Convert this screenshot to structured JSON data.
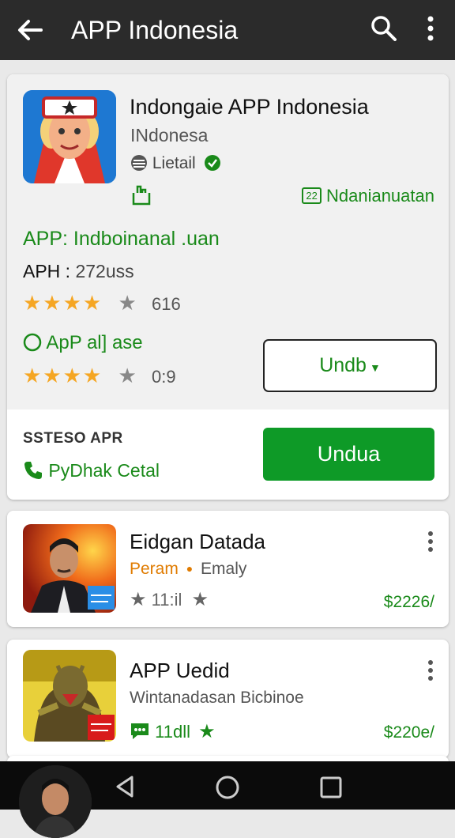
{
  "appbar": {
    "title": "APP Indonesia"
  },
  "featured": {
    "name": "Indongaie APP Indonesia",
    "developer": "INdonesa",
    "publisher": "Lietail",
    "note": "Ndanianuatan",
    "note_number": "22",
    "headline": "APP: Indboinanal .uan",
    "aph_label": "APH :",
    "aph_value": "272uss",
    "rating1_value": "616",
    "status": "ApP al] ase",
    "rating2_value": "0:9",
    "dropdown_label": "Undb",
    "section_label": "SSTESO APR",
    "contact": "PyDhak Cetal",
    "install_label": "Undua"
  },
  "list": [
    {
      "title": "Eidgan Datada",
      "tag1": "Peram",
      "tag2": "Emaly",
      "rating": "11:il",
      "price": "$2226/",
      "badge": "Xdo"
    },
    {
      "title": "APP Uedid",
      "subtitle": "Wintanadasan Bicbinoe",
      "rating": "11dll",
      "price": "$220e/",
      "badge": "Xdo"
    }
  ],
  "colors": {
    "accent": "#0e9a27",
    "green_text": "#1a8a1a",
    "star": "#f5a623",
    "appbar": "#2b2b2b"
  }
}
